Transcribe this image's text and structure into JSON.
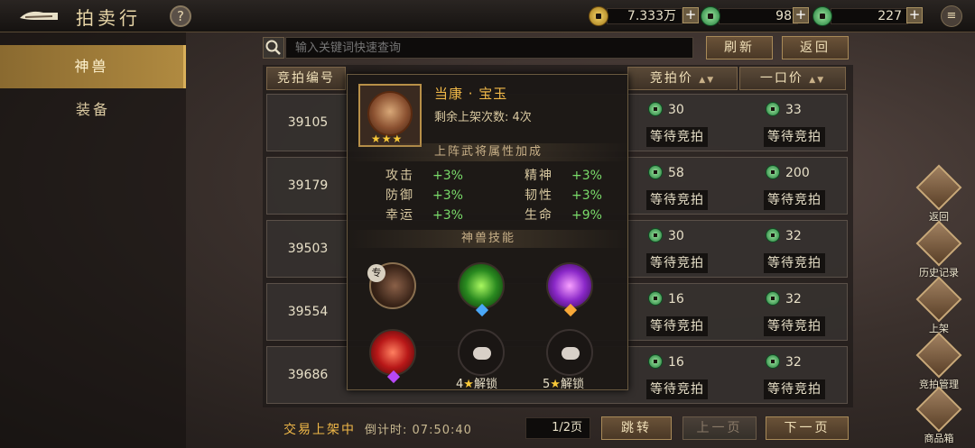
{
  "header": {
    "title": "拍卖行",
    "help_label": "?",
    "menu_label": "≡",
    "currencies": [
      {
        "icon": "gold-coin-icon",
        "value": "7.333万"
      },
      {
        "icon": "jade-coin-icon",
        "value": "98"
      },
      {
        "icon": "jade-coin-icon",
        "value": "227"
      }
    ]
  },
  "sidebar": {
    "items": [
      {
        "label": "神兽",
        "active": true
      },
      {
        "label": "装备",
        "active": false
      }
    ]
  },
  "search": {
    "placeholder": "输入关键词快速查询",
    "refresh_label": "刷新",
    "return_label": "返回"
  },
  "table": {
    "headers": [
      "竞拍编号",
      "竞拍价",
      "一口价"
    ],
    "status_text": "等待竞拍",
    "rows": [
      {
        "id": "39105",
        "bid": "30",
        "buyout": "33"
      },
      {
        "id": "39179",
        "bid": "58",
        "buyout": "200"
      },
      {
        "id": "39503",
        "bid": "30",
        "buyout": "32"
      },
      {
        "id": "39554",
        "bid": "16",
        "buyout": "32"
      },
      {
        "id": "39686",
        "bid": "16",
        "buyout": "32"
      }
    ]
  },
  "popup": {
    "name": "当康 · 宝玉",
    "stars": "★★★",
    "remain": "剩余上架次数: 4次",
    "attr_title": "上阵武将属性加成",
    "attrs": [
      {
        "k": "攻击",
        "v": "+3%"
      },
      {
        "k": "精神",
        "v": "+3%"
      },
      {
        "k": "防御",
        "v": "+3%"
      },
      {
        "k": "韧性",
        "v": "+3%"
      },
      {
        "k": "幸运",
        "v": "+3%"
      },
      {
        "k": "生命",
        "v": "+9%"
      }
    ],
    "skill_title": "神兽技能",
    "skill_badge": "专",
    "unlock_text": "解锁",
    "unlock_a": "4",
    "unlock_b": "5"
  },
  "right_actions": [
    "返回",
    "历史记录",
    "上架",
    "竞拍管理",
    "商品箱"
  ],
  "bottom": {
    "trade_status": "交易上架中",
    "countdown_label": "倒计时:",
    "countdown": "07:50:40",
    "page": "1/2页",
    "jump_label": "跳转",
    "prev_label": "上一页",
    "next_label": "下一页"
  }
}
